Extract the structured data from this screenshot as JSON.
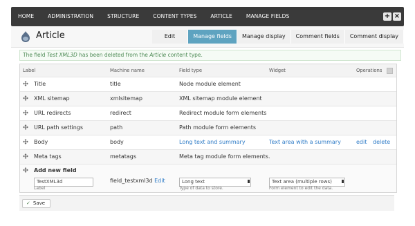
{
  "toolbar": {
    "items": [
      "HOME",
      "ADMINISTRATION",
      "STRUCTURE",
      "CONTENT TYPES",
      "ARTICLE",
      "MANAGE FIELDS"
    ],
    "add_icon": "+",
    "close_icon": "×"
  },
  "header": {
    "title": "Article",
    "tabs": [
      "Edit",
      "Manage fields",
      "Manage display",
      "Comment fields",
      "Comment display"
    ]
  },
  "message": {
    "prefix": "The field ",
    "field_name": "Test XML3D",
    "middle": " has been deleted from the ",
    "content_type": "Article",
    "suffix": " content type."
  },
  "table": {
    "headers": {
      "label": "Label",
      "machine": "Machine name",
      "type": "Field type",
      "widget": "Widget",
      "ops": "Operations"
    },
    "rows": [
      {
        "label": "Title",
        "machine": "title",
        "type": "Node module element",
        "widget": "",
        "ops1": "",
        "ops2": ""
      },
      {
        "label": "XML sitemap",
        "machine": "xmlsitemap",
        "type": "XML sitemap module element",
        "widget": "",
        "ops1": "",
        "ops2": ""
      },
      {
        "label": "URL redirects",
        "machine": "redirect",
        "type": "Redirect module form elements",
        "widget": "",
        "ops1": "",
        "ops2": ""
      },
      {
        "label": "URL path settings",
        "machine": "path",
        "type": "Path module form elements",
        "widget": "",
        "ops1": "",
        "ops2": ""
      },
      {
        "label": "Body",
        "machine": "body",
        "type": "Long text and summary",
        "widget": "Text area with a summary",
        "ops1": "edit",
        "ops2": "delete"
      },
      {
        "label": "Meta tags",
        "machine": "metatags",
        "type": "Meta tag module form elements.",
        "widget": "",
        "ops1": "",
        "ops2": ""
      }
    ],
    "new_field": {
      "title": "Add new field",
      "label_value": "TestXML3d",
      "label_sublabel": "Label",
      "machine_value": "field_testxml3d",
      "machine_edit": "Edit",
      "type_value": "Long text",
      "type_sublabel": "Type of data to store.",
      "widget_value": "Text area (multiple rows)",
      "widget_sublabel": "Form element to edit the data."
    }
  },
  "actions": {
    "save_label": "Save"
  }
}
